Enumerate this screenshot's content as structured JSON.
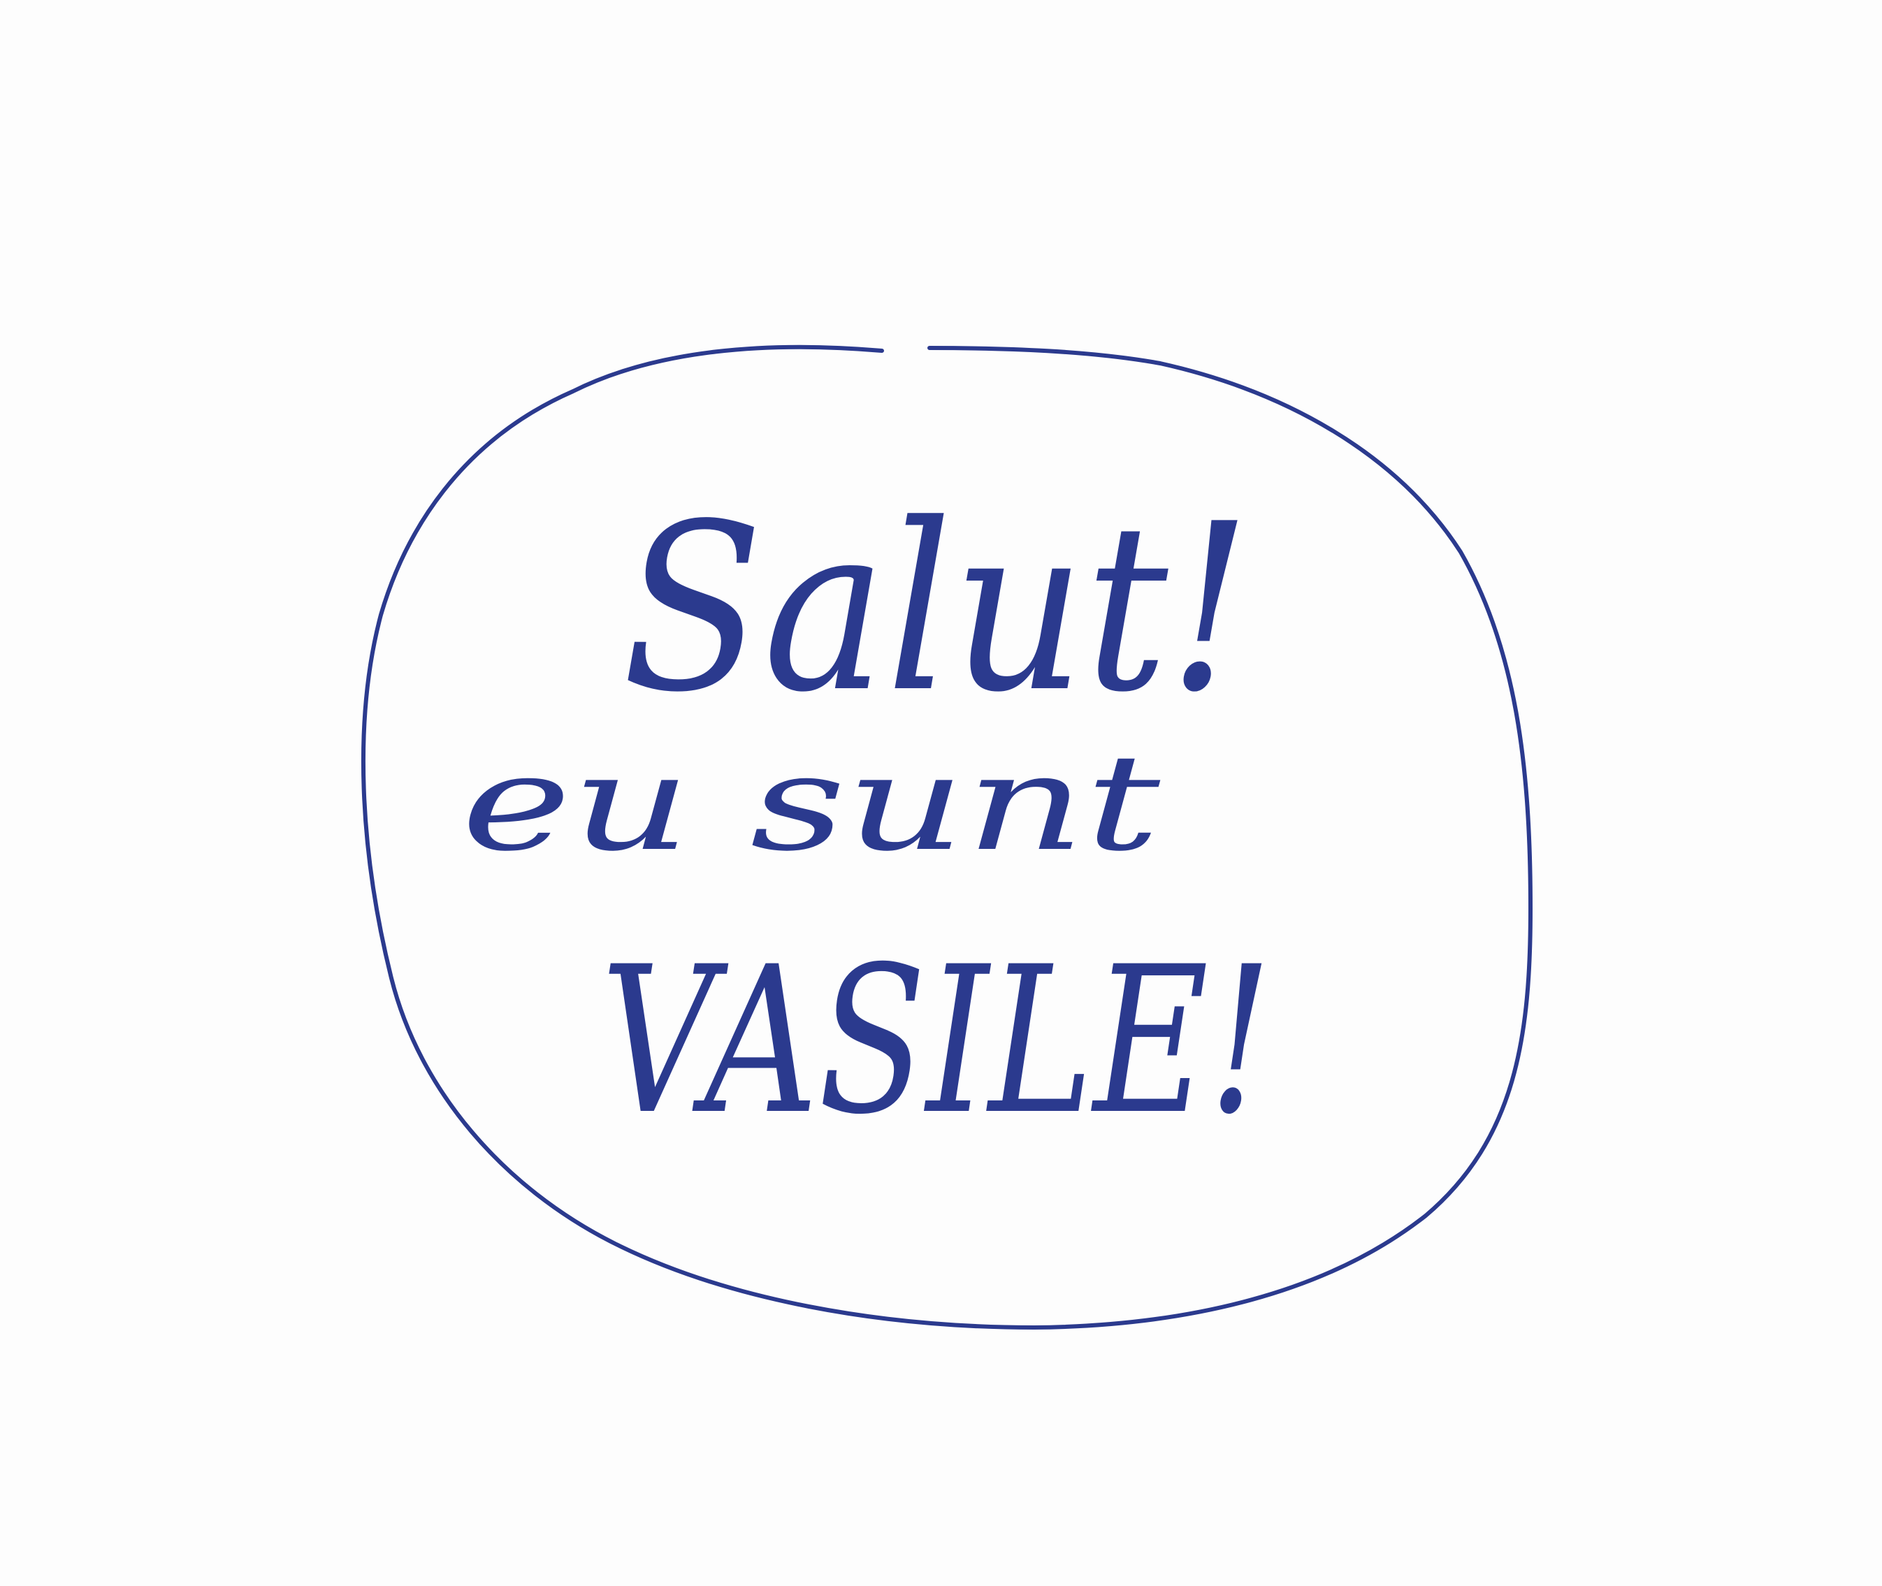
{
  "speech_bubble": {
    "lines": [
      "Salut!",
      "eu sunt",
      "VASILE!"
    ]
  },
  "colors": {
    "ink": "#2b3a8e",
    "paper": "#fdfdfd"
  }
}
